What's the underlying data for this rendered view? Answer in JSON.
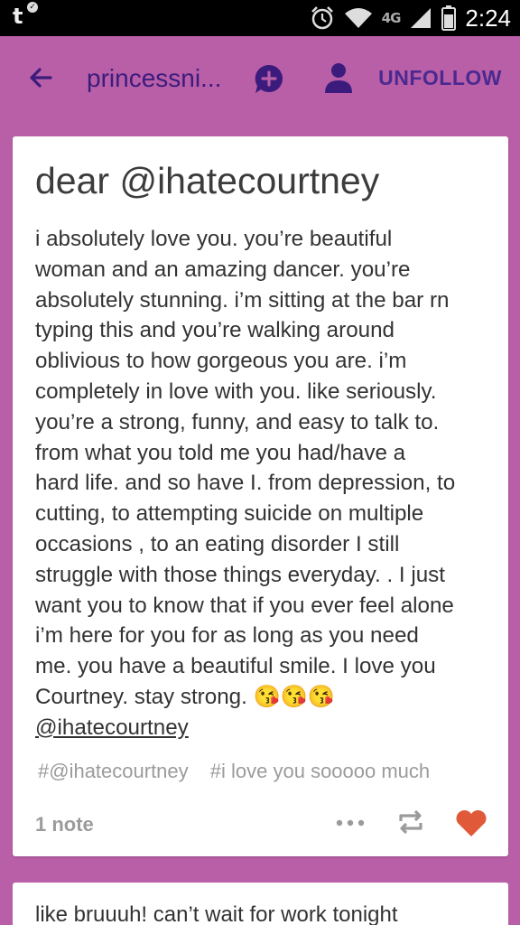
{
  "status_bar": {
    "left_glyph": "t",
    "network": "4G",
    "time": "2:24",
    "icons": [
      "alarm-icon",
      "wifi-icon",
      "signal-icon",
      "battery-icon"
    ]
  },
  "app_bar": {
    "blog_name": "princessni...",
    "unfollow_label": "UNFOLLOW",
    "icons": [
      "back-arrow-icon",
      "message-plus-icon",
      "user-icon"
    ],
    "colors": {
      "bar_bg": "#b95fa8",
      "accent": "#4a2990"
    }
  },
  "post": {
    "title": "dear @ihatecourtney",
    "body": "i absolutely love you. you’re beautiful\nwoman and an amazing dancer. you’re\nabsolutely stunning. i’m sitting at the bar rn\ntyping this and you’re walking around\noblivious to how gorgeous you are. i’m\ncompletely in love with you. like seriously.\nyou’re a strong, funny, and easy to talk to.\nfrom what you told me you had/have a\nhard life. and so have I. from depression, to\ncutting, to attempting suicide on multiple\noccasions , to an eating disorder I still\nstruggle with those things everyday. . I just\nwant you to know that if you ever feel alone\ni’m here for you for as long as you need\nme. you have a beautiful smile. I love you\nCourtney. stay strong. 😘😘😘",
    "mention": "@ihatecourtney",
    "tags": [
      "#@ihatecourtney",
      "#i love you sooooo much"
    ],
    "notes": "1 note",
    "actions": [
      "more-icon",
      "reblog-icon",
      "heart-icon"
    ],
    "heart_color": "#e05a3a"
  },
  "next_post": {
    "text_preview": "like bruuuh! can’t wait for work tonight"
  }
}
